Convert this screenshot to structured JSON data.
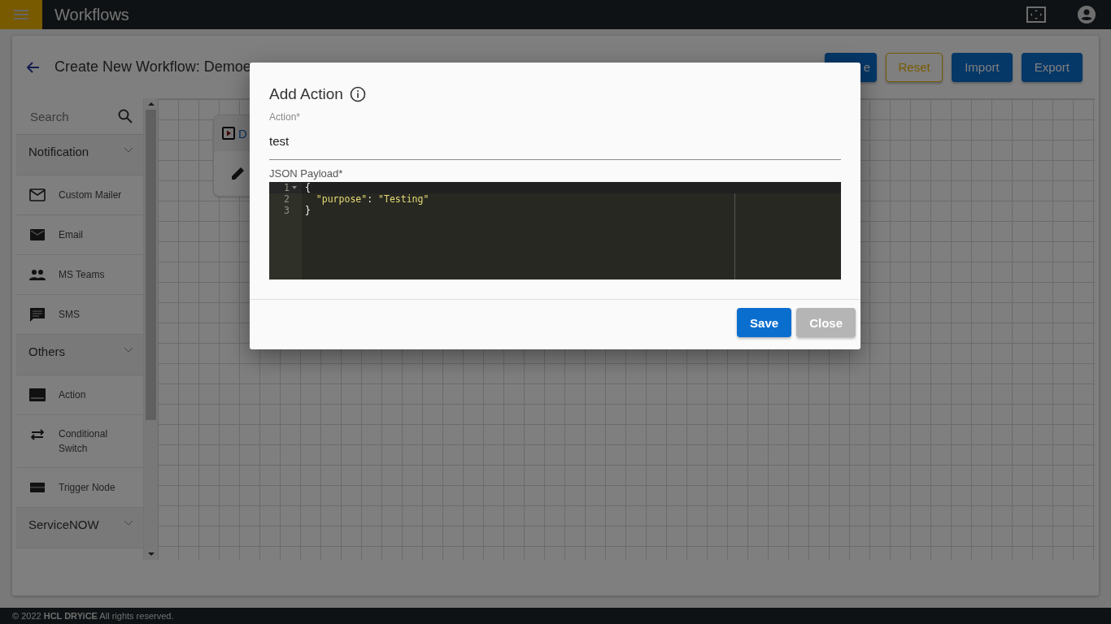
{
  "app_bar": {
    "title": "Workflows"
  },
  "page": {
    "title": "Create New Workflow: Demoe",
    "buttons": [
      {
        "label": "e",
        "kind": "primary"
      },
      {
        "label": "Reset",
        "kind": "outline"
      },
      {
        "label": "Import",
        "kind": "primary"
      },
      {
        "label": "Export",
        "kind": "primary"
      }
    ]
  },
  "sidebar": {
    "search": {
      "placeholder": "Search"
    },
    "groups": [
      {
        "label": "Notification",
        "items": [
          {
            "label": "Custom Mailer",
            "kind": "envelope"
          },
          {
            "label": "Email",
            "kind": "mail"
          },
          {
            "label": "MS Teams",
            "kind": "people"
          },
          {
            "label": "SMS",
            "kind": "message"
          }
        ]
      },
      {
        "label": "Others",
        "items": [
          {
            "label": "Action",
            "kind": "panel"
          },
          {
            "label": "Conditional Switch",
            "kind": "swap"
          },
          {
            "label": "Trigger Node",
            "kind": "bar"
          }
        ]
      },
      {
        "label": "ServiceNOW"
      }
    ]
  },
  "canvas": {
    "node": {
      "label": "D"
    }
  },
  "dialog": {
    "title": "Add Action",
    "action": {
      "label": "Action*",
      "value": "test"
    },
    "payload": {
      "label": "JSON Payload*",
      "lines": [
        {
          "number": "1",
          "foldable": true,
          "tokens": [
            {
              "text": "{",
              "kind": "plain"
            }
          ]
        },
        {
          "number": "2",
          "foldable": false,
          "tokens": [
            {
              "text": "  \"purpose\"",
              "kind": "string"
            },
            {
              "text": ": ",
              "kind": "plain"
            },
            {
              "text": "\"Testing\"",
              "kind": "string"
            }
          ]
        },
        {
          "number": "3",
          "foldable": false,
          "tokens": [
            {
              "text": "}",
              "kind": "plain"
            }
          ]
        }
      ]
    },
    "buttons": [
      {
        "label": "Save",
        "kind": "primary"
      },
      {
        "label": "Close",
        "kind": "secondary"
      }
    ]
  },
  "footer": {
    "text": "© 2022 **HCL DRYiCE** All rights reserved."
  }
}
